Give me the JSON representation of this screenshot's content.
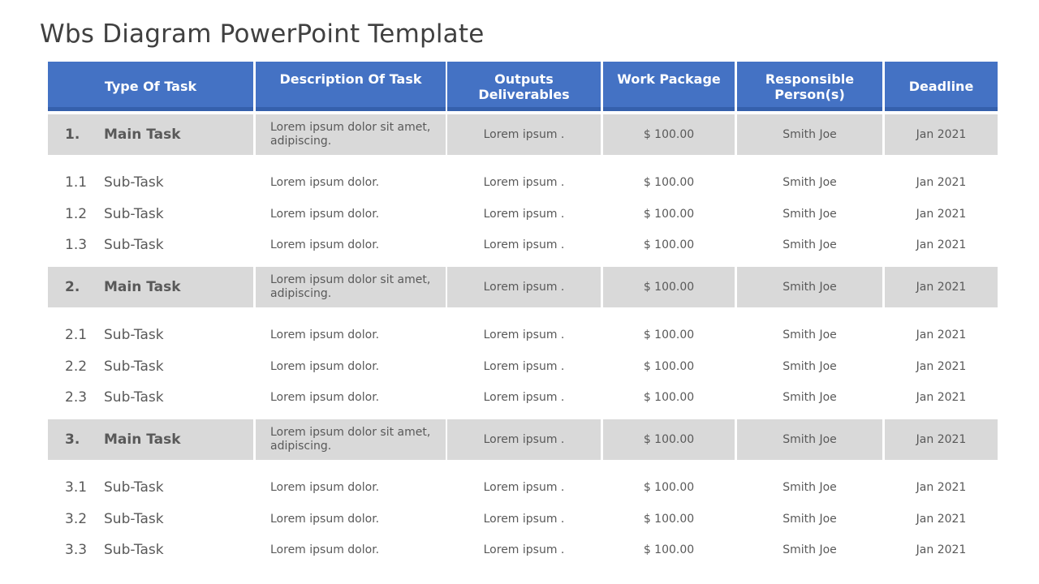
{
  "title": "Wbs Diagram PowerPoint Template",
  "colors": {
    "header_bg": "#4472c4",
    "main_row_bg": "#d9d9d9",
    "text": "#595959"
  },
  "headers": [
    "Type Of Task",
    "Description  Of Task",
    "Outputs Deliverables",
    "Work Package",
    "Responsible Person(s)",
    "Deadline"
  ],
  "groups": [
    {
      "main": {
        "num": "1.",
        "task": "Main Task",
        "description": "Lorem ipsum dolor sit amet, adipiscing.",
        "output": "Lorem ipsum .",
        "work_package": "$ 100.00",
        "person": "Smith Joe",
        "deadline": "Jan 2021"
      },
      "subs": [
        {
          "num": "1.1",
          "task": "Sub-Task",
          "description": "Lorem ipsum dolor.",
          "output": "Lorem ipsum .",
          "work_package": "$ 100.00",
          "person": "Smith Joe",
          "deadline": "Jan 2021"
        },
        {
          "num": "1.2",
          "task": "Sub-Task",
          "description": "Lorem ipsum dolor.",
          "output": "Lorem ipsum .",
          "work_package": "$ 100.00",
          "person": "Smith Joe",
          "deadline": "Jan 2021"
        },
        {
          "num": "1.3",
          "task": "Sub-Task",
          "description": "Lorem ipsum dolor.",
          "output": "Lorem ipsum .",
          "work_package": "$ 100.00",
          "person": "Smith Joe",
          "deadline": "Jan 2021"
        }
      ]
    },
    {
      "main": {
        "num": "2.",
        "task": "Main Task",
        "description": "Lorem ipsum dolor sit amet, adipiscing.",
        "output": "Lorem ipsum .",
        "work_package": "$ 100.00",
        "person": "Smith Joe",
        "deadline": "Jan 2021"
      },
      "subs": [
        {
          "num": "2.1",
          "task": "Sub-Task",
          "description": "Lorem ipsum dolor.",
          "output": "Lorem ipsum .",
          "work_package": "$ 100.00",
          "person": "Smith Joe",
          "deadline": "Jan 2021"
        },
        {
          "num": "2.2",
          "task": "Sub-Task",
          "description": "Lorem ipsum dolor.",
          "output": "Lorem ipsum .",
          "work_package": "$ 100.00",
          "person": "Smith Joe",
          "deadline": "Jan 2021"
        },
        {
          "num": "2.3",
          "task": "Sub-Task",
          "description": "Lorem ipsum dolor.",
          "output": "Lorem ipsum .",
          "work_package": "$ 100.00",
          "person": "Smith Joe",
          "deadline": "Jan 2021"
        }
      ]
    },
    {
      "main": {
        "num": "3.",
        "task": "Main Task",
        "description": "Lorem ipsum dolor sit amet, adipiscing.",
        "output": "Lorem ipsum .",
        "work_package": "$ 100.00",
        "person": "Smith Joe",
        "deadline": "Jan 2021"
      },
      "subs": [
        {
          "num": "3.1",
          "task": "Sub-Task",
          "description": "Lorem ipsum dolor.",
          "output": "Lorem ipsum .",
          "work_package": "$ 100.00",
          "person": "Smith Joe",
          "deadline": "Jan 2021"
        },
        {
          "num": "3.2",
          "task": "Sub-Task",
          "description": "Lorem ipsum dolor.",
          "output": "Lorem ipsum .",
          "work_package": "$ 100.00",
          "person": "Smith Joe",
          "deadline": "Jan 2021"
        },
        {
          "num": "3.3",
          "task": "Sub-Task",
          "description": "Lorem ipsum dolor.",
          "output": "Lorem ipsum .",
          "work_package": "$ 100.00",
          "person": "Smith Joe",
          "deadline": "Jan 2021"
        }
      ]
    }
  ]
}
